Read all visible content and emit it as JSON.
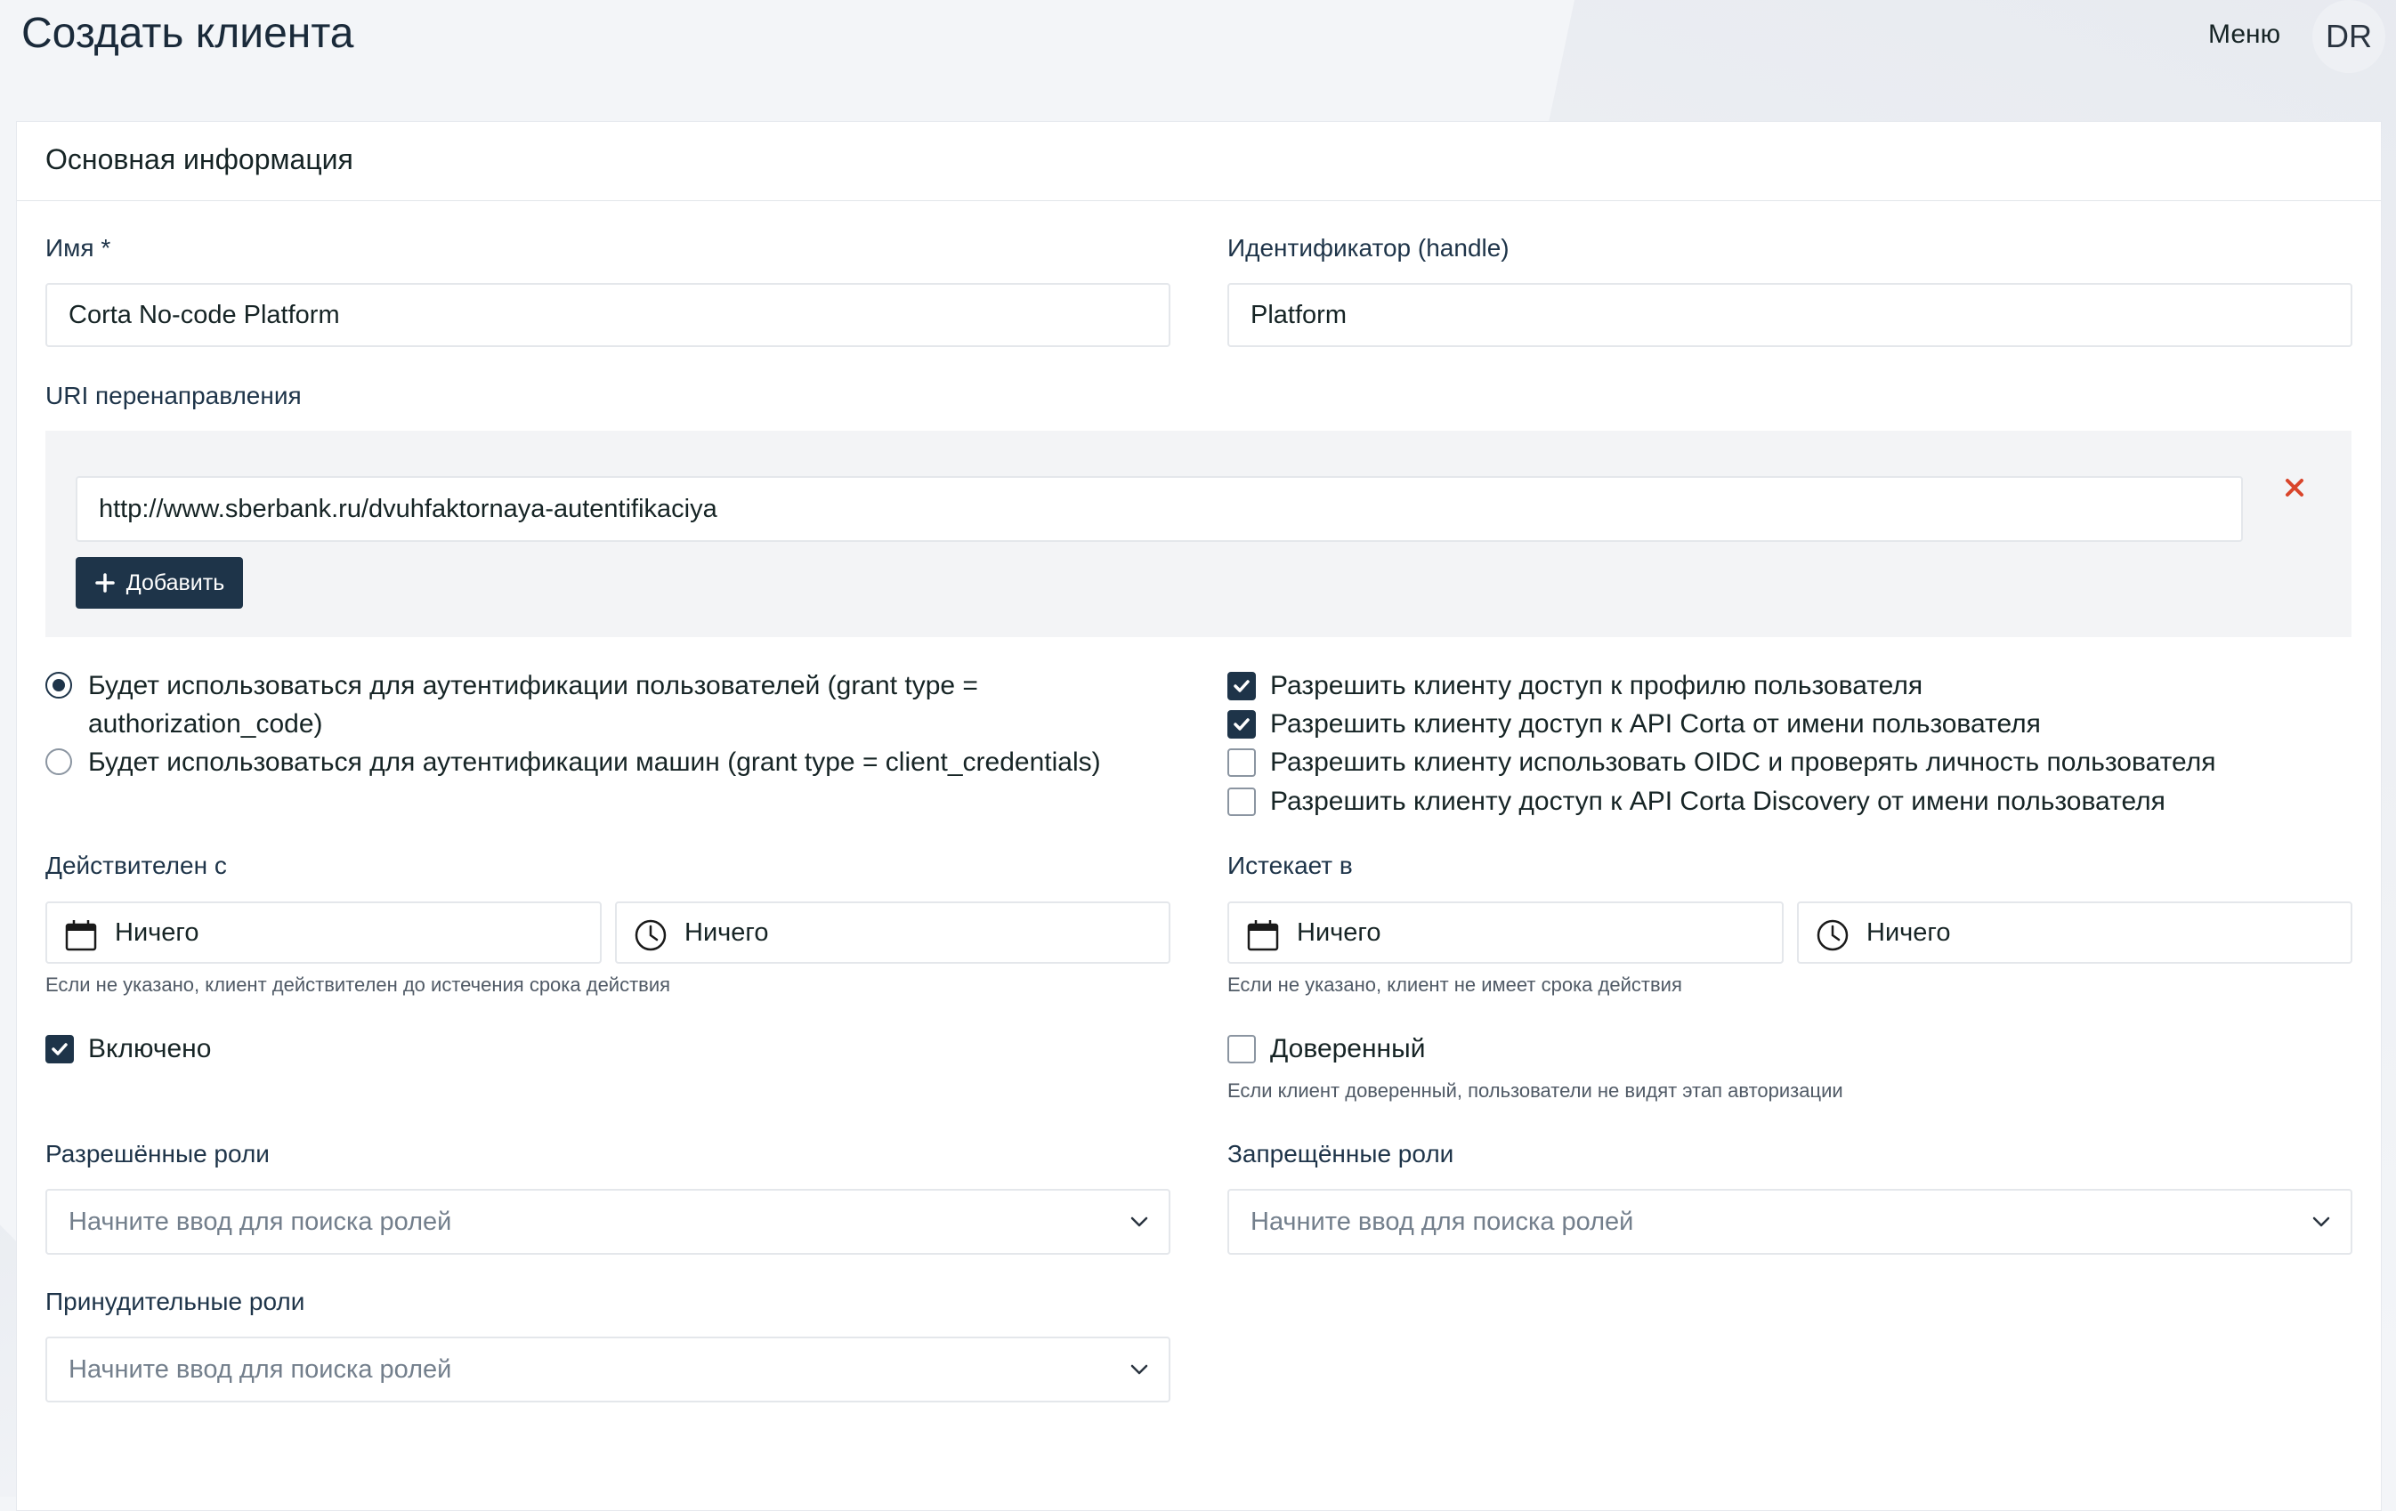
{
  "header": {
    "title": "Создать клиента",
    "menu_label": "Меню",
    "avatar_initials": "DR"
  },
  "card": {
    "title": "Основная информация"
  },
  "fields": {
    "name": {
      "label": "Имя *",
      "value": "Corta No-code Platform"
    },
    "handle": {
      "label": "Идентификатор (handle)",
      "value": "Platform"
    },
    "redirect": {
      "label": "URI перенаправления",
      "value": "http://www.sberbank.ru/dvuhfaktornaya-autentifikaciya",
      "add_label": "Добавить"
    }
  },
  "grant_options": [
    {
      "line1": "Будет использоваться для аутентификации пользователей (grant type =",
      "line2": "authorization_code)",
      "selected": true
    },
    {
      "line1": "Будет использоваться для аутентификации машин (grant type = client_credentials)",
      "selected": false
    }
  ],
  "permissions": [
    {
      "label": "Разрешить клиенту доступ к профилю пользователя",
      "checked": true
    },
    {
      "label": "Разрешить клиенту доступ к API Corta от имени пользователя",
      "checked": true
    },
    {
      "label": "Разрешить клиенту использовать OIDC и проверять личность пользователя",
      "checked": false
    },
    {
      "label": "Разрешить клиенту доступ к API Corta Discovery от имени пользователя",
      "checked": false
    }
  ],
  "valid_from": {
    "label": "Действителен с",
    "date_value": "Ничего",
    "time_value": "Ничего",
    "help": "Если не указано, клиент действителен до истечения срока действия"
  },
  "expires_at": {
    "label": "Истекает в",
    "date_value": "Ничего",
    "time_value": "Ничего",
    "help": "Если не указано, клиент не имеет срока действия"
  },
  "enabled": {
    "label": "Включено",
    "checked": true
  },
  "trusted": {
    "label": "Доверенный",
    "checked": false,
    "help": "Если клиент доверенный, пользователи не видят этап авторизации"
  },
  "roles": {
    "allowed": {
      "label": "Разрешённые роли",
      "placeholder": "Начните ввод для поиска ролей"
    },
    "denied": {
      "label": "Запрещённые роли",
      "placeholder": "Начните ввод для поиска ролей"
    },
    "forced": {
      "label": "Принудительные роли",
      "placeholder": "Начните ввод для поиска ролей"
    }
  },
  "colors": {
    "primary": "#1e3449",
    "danger": "#d9452b",
    "border": "#e4e7eb"
  }
}
